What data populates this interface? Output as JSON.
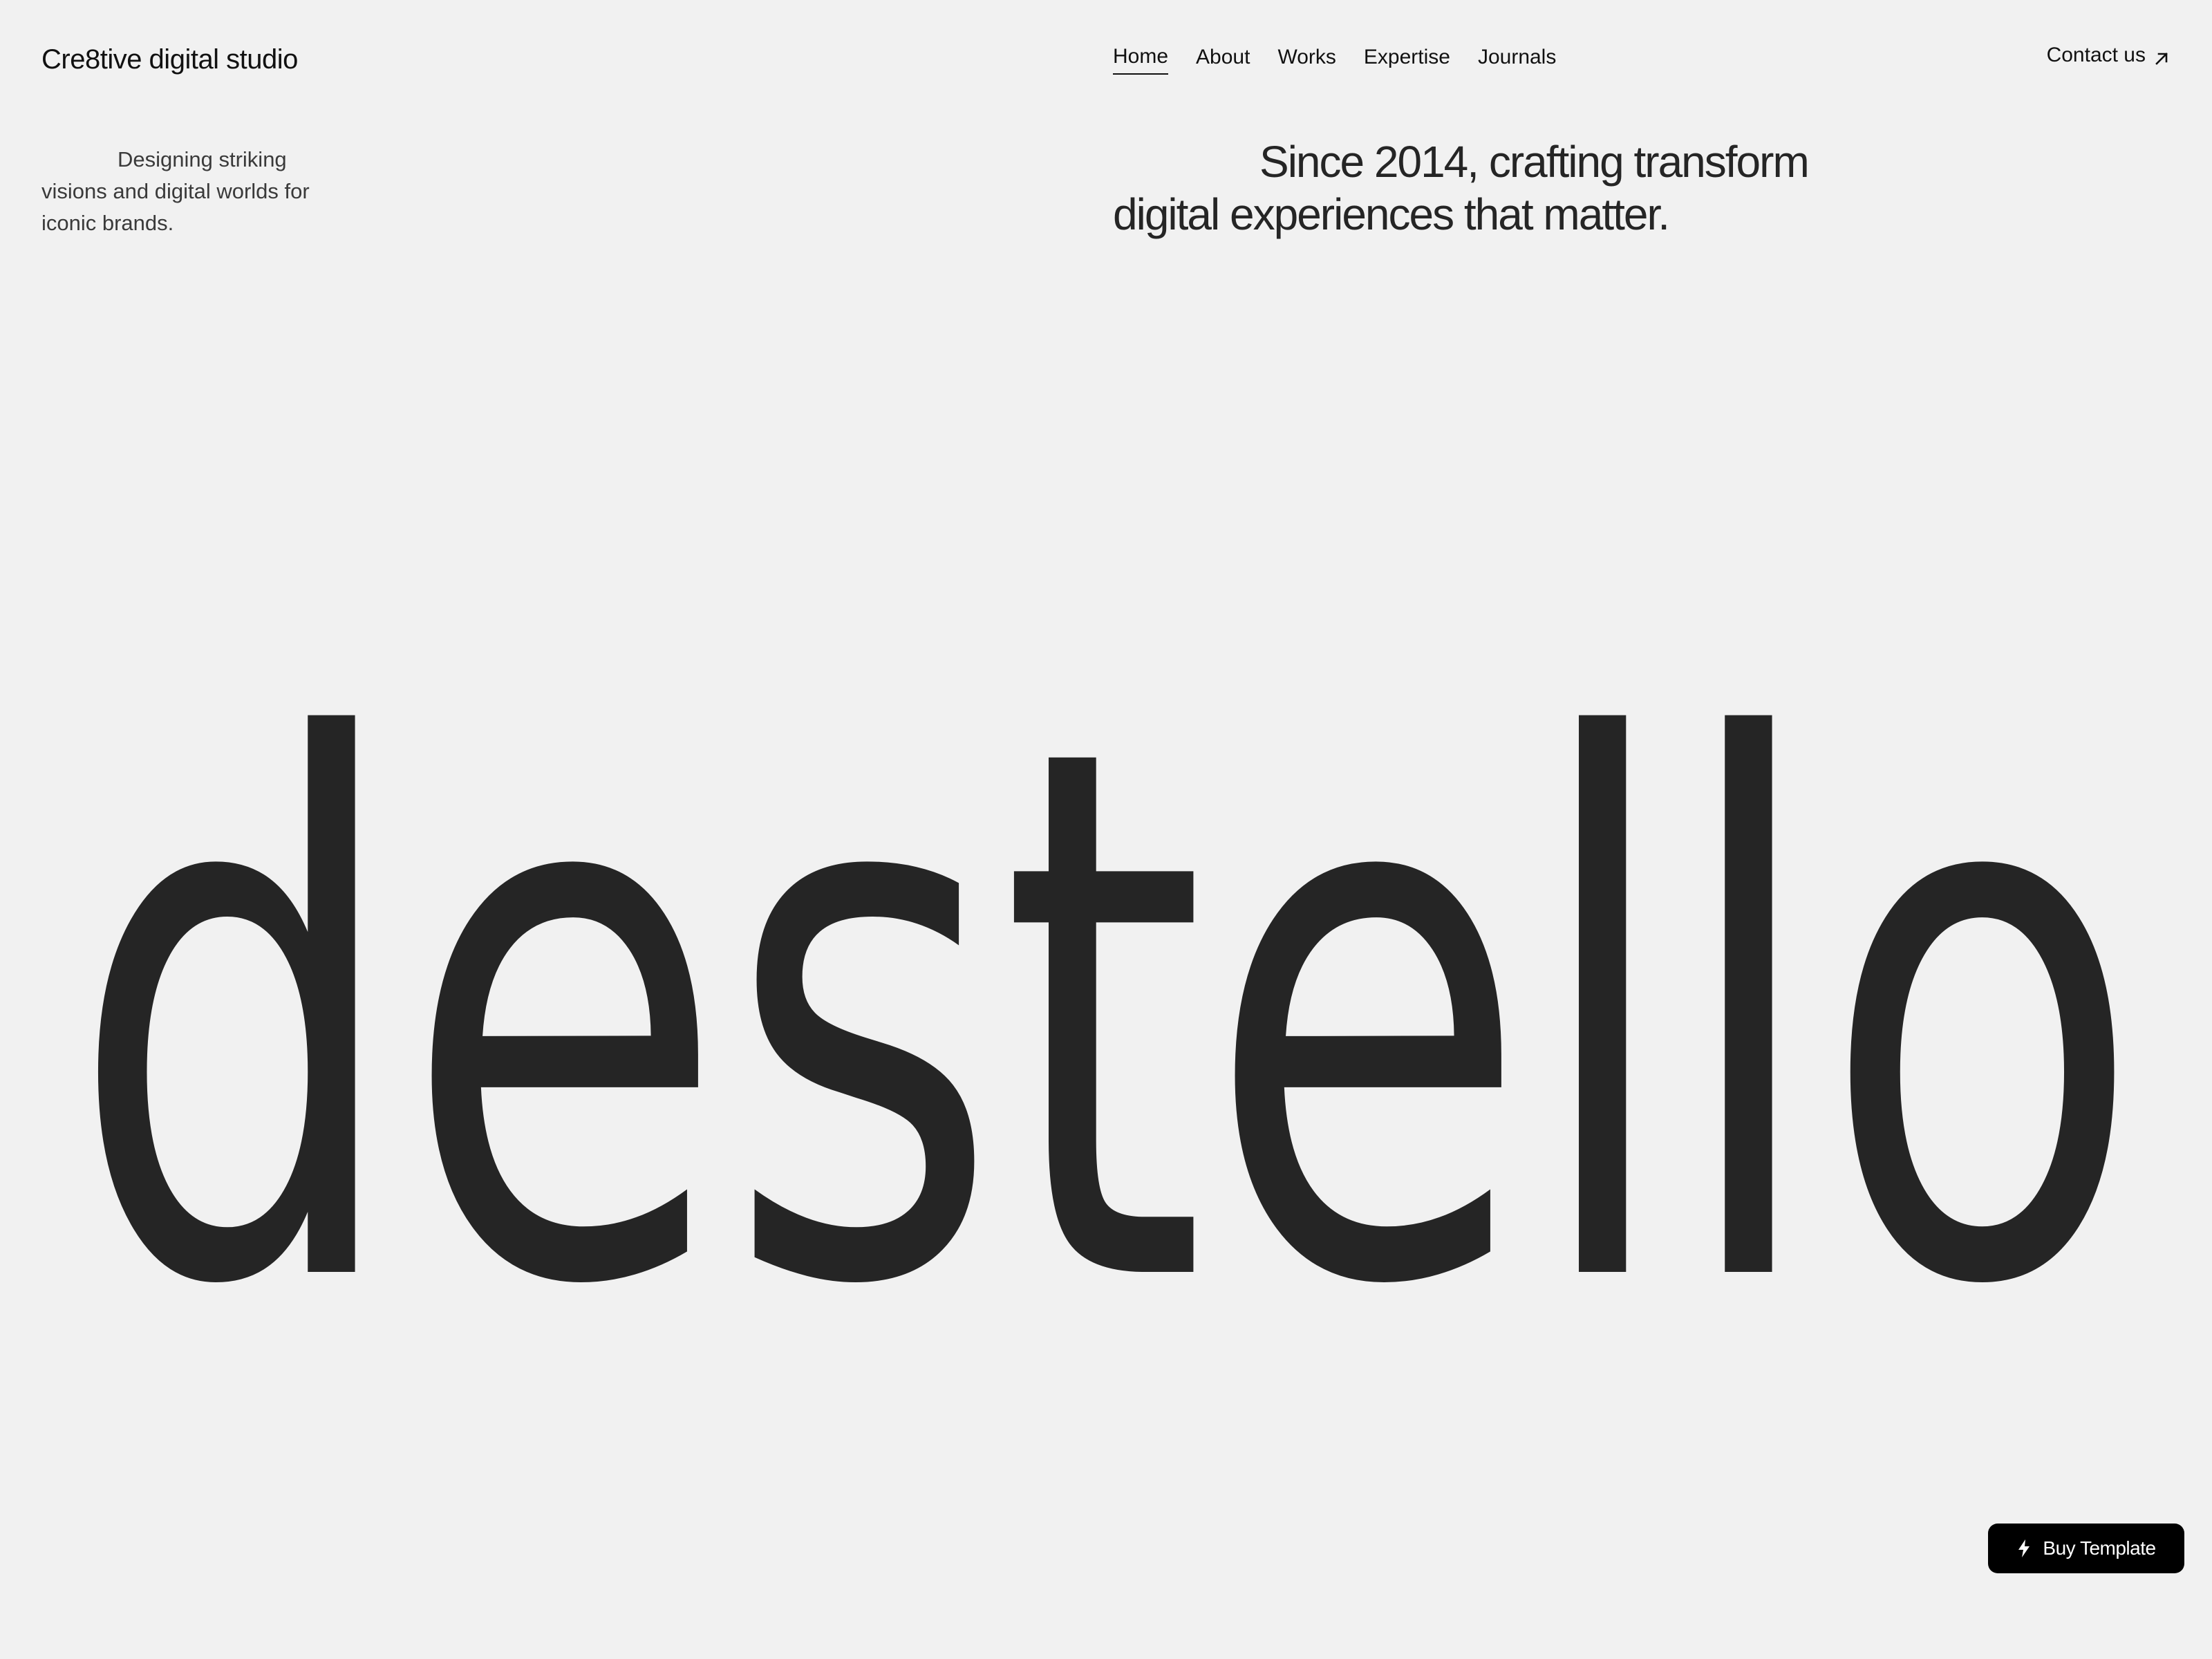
{
  "header": {
    "brand": "Cre8tive digital studio",
    "nav": [
      {
        "label": "Home",
        "active": true
      },
      {
        "label": "About",
        "active": false
      },
      {
        "label": "Works",
        "active": false
      },
      {
        "label": "Expertise",
        "active": false
      },
      {
        "label": "Journals",
        "active": false
      }
    ],
    "contact_label": "Contact us",
    "contact_icon": "arrow-up-right-icon"
  },
  "hero": {
    "intro": "Designing striking visions and digital worlds for iconic brands.",
    "tagline": "Since 2014, crafting transform digital experiences that matter.",
    "wordmark": "destello"
  },
  "floating": {
    "buy_label": "Buy Template",
    "buy_icon": "lightning-bolt-icon"
  },
  "colors": {
    "background": "#f1f1f1",
    "text": "#252525",
    "button": "#000000"
  }
}
